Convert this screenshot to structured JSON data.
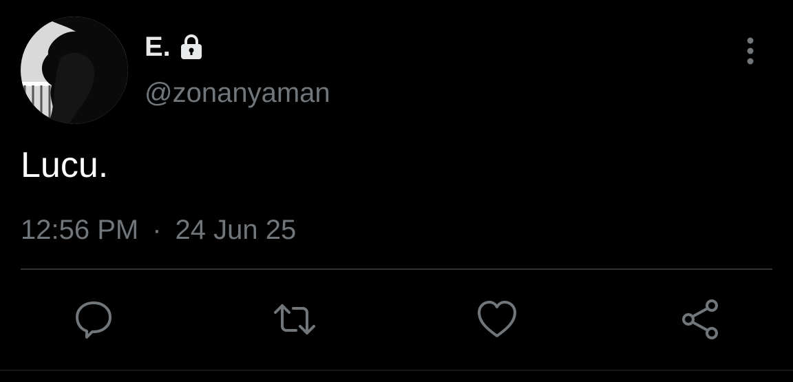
{
  "tweet": {
    "display_name": "E.",
    "handle": "@zonanyaman",
    "text": "Lucu.",
    "time": "12:56 PM",
    "separator": "·",
    "date": "24 Jun 25"
  },
  "icons": {
    "lock": "lock-icon",
    "more": "more-vertical-icon",
    "reply": "reply-icon",
    "retweet": "retweet-icon",
    "like": "heart-icon",
    "share": "share-icon"
  },
  "colors": {
    "background": "#000000",
    "primary_text": "#e7e9ea",
    "secondary_text": "#71767b",
    "divider": "#2f3336"
  }
}
